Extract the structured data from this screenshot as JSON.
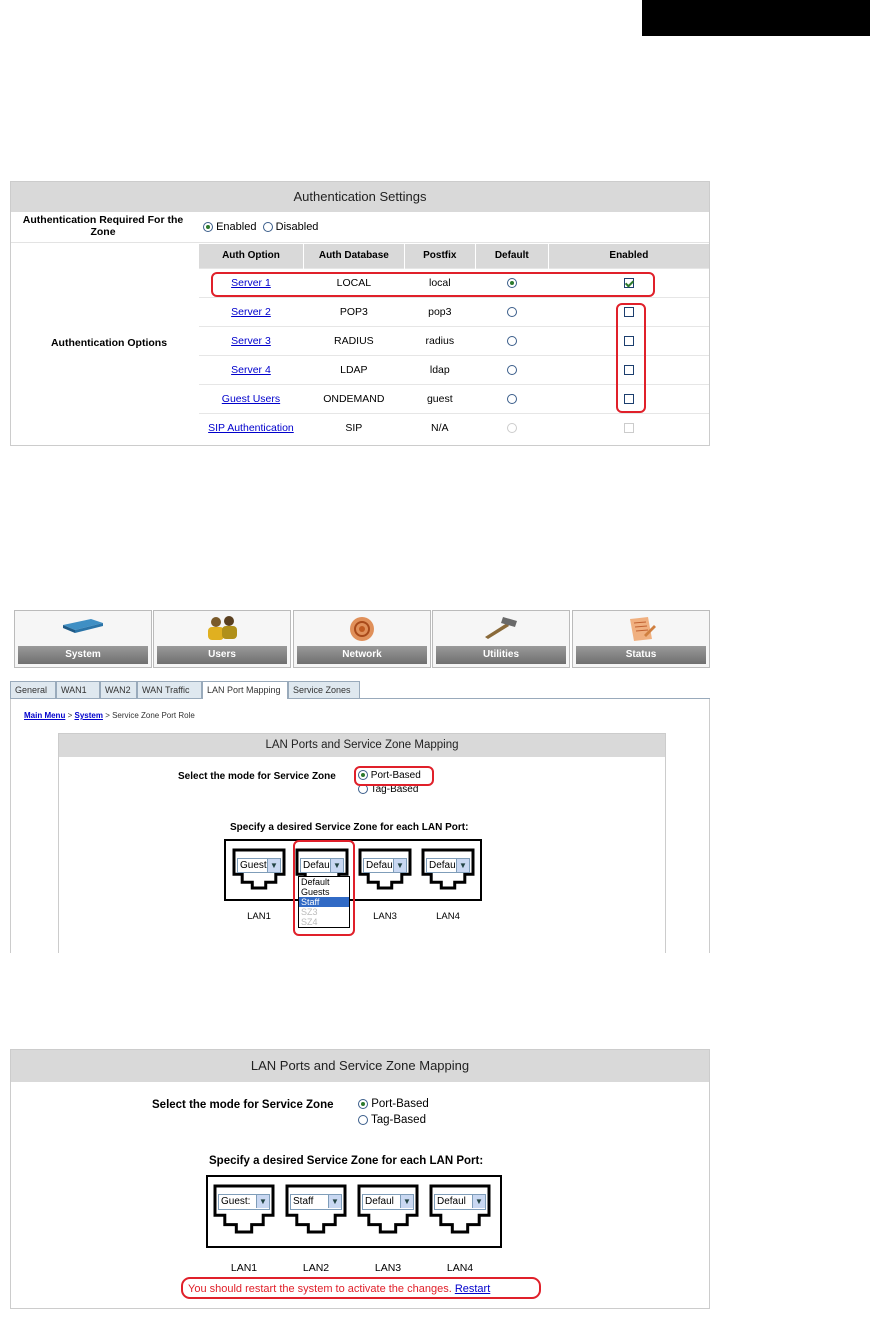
{
  "auth": {
    "title": "Authentication Settings",
    "required_label": "Authentication Required For the Zone",
    "enabled_opt": "Enabled",
    "disabled_opt": "Disabled",
    "options_label": "Authentication Options",
    "headers": [
      "Auth Option",
      "Auth Database",
      "Postfix",
      "Default",
      "Enabled"
    ],
    "rows": [
      {
        "option": "Server 1",
        "db": "LOCAL",
        "postfix": "local",
        "default": true,
        "enabled": true
      },
      {
        "option": "Server 2",
        "db": "POP3",
        "postfix": "pop3",
        "default": false,
        "enabled": false
      },
      {
        "option": "Server 3",
        "db": "RADIUS",
        "postfix": "radius",
        "default": false,
        "enabled": false
      },
      {
        "option": "Server 4",
        "db": "LDAP",
        "postfix": "ldap",
        "default": false,
        "enabled": false
      },
      {
        "option": "Guest Users",
        "db": "ONDEMAND",
        "postfix": "guest",
        "default": false,
        "enabled": false
      },
      {
        "option": "SIP Authentication",
        "db": "SIP",
        "postfix": "N/A",
        "default": false,
        "enabled": false
      }
    ]
  },
  "nav": {
    "tiles": [
      "System",
      "Users",
      "Network",
      "Utilities",
      "Status"
    ],
    "tabs": [
      "General",
      "WAN1",
      "WAN2",
      "WAN Traffic",
      "LAN Port Mapping",
      "Service Zones"
    ],
    "breadcrumb": {
      "main": "Main Menu",
      "sep": ">",
      "system": "System",
      "page": "Service Zone Port Role"
    }
  },
  "mapping1": {
    "title": "LAN Ports and Service Zone Mapping",
    "mode_label": "Select the mode for Service Zone",
    "port_based": "Port-Based",
    "tag_based": "Tag-Based",
    "specify": "Specify a desired Service Zone for each LAN Port:",
    "ports": [
      {
        "label": "LAN1",
        "value": "Guest:"
      },
      {
        "label": "LAN2",
        "value": "Defaul"
      },
      {
        "label": "LAN3",
        "value": "Defaul"
      },
      {
        "label": "LAN4",
        "value": "Defaul"
      }
    ],
    "dropdown": [
      "Default",
      "Guests",
      "Staff",
      "SZ3",
      "SZ4"
    ]
  },
  "mapping2": {
    "title": "LAN Ports and Service Zone Mapping",
    "mode_label": "Select the mode for Service Zone",
    "port_based": "Port-Based",
    "tag_based": "Tag-Based",
    "specify": "Specify a desired Service Zone for each LAN Port:",
    "ports": [
      {
        "label": "LAN1",
        "value": "Guest:"
      },
      {
        "label": "LAN2",
        "value": "Staff"
      },
      {
        "label": "LAN3",
        "value": "Defaul"
      },
      {
        "label": "LAN4",
        "value": "Defaul"
      }
    ],
    "restart_msg": "You should restart the system to activate the changes.",
    "restart_link": "Restart"
  },
  "colors": {
    "highlight": "#e0202a",
    "link": "#0000cc",
    "header_bg": "#d9d9d9",
    "selected_item": "#316ac5"
  }
}
